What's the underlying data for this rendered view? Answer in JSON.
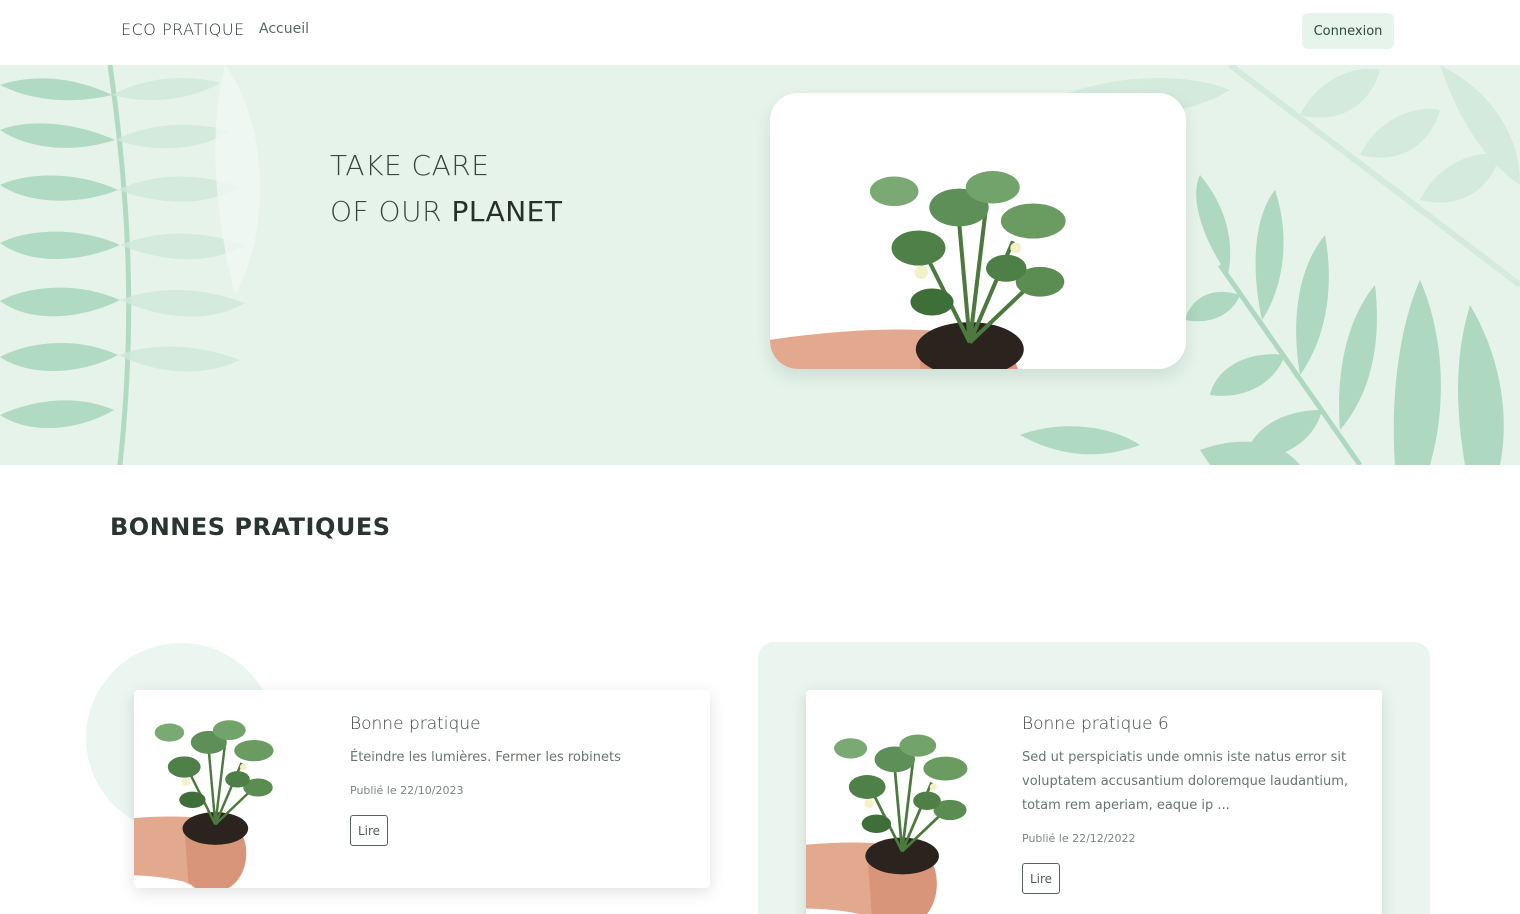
{
  "navbar": {
    "brand": "ECO PRATIQUE",
    "links": [
      "Accueil"
    ],
    "login_label": "Connexion"
  },
  "hero": {
    "title_line1": "TAKE CARE",
    "title_line2_light": "OF OUR ",
    "title_line2_bold": "PLANET"
  },
  "section": {
    "title": "BONNES PRATIQUES"
  },
  "cards": [
    {
      "title": "Bonne pratique",
      "text": "Éteindre les lumières. Fermer les robinets",
      "date": "Publié le 22/10/2023",
      "button": "Lire"
    },
    {
      "title": "Bonne pratique 6",
      "text": "Sed ut perspiciatis unde omnis iste natus error sit voluptatem accusantium doloremque laudantium, totam rem aperiam, eaque ip ...",
      "date": "Publié le 22/12/2022",
      "button": "Lire"
    }
  ],
  "colors": {
    "hero_bg": "#e5f3eb",
    "leaf": "#a9d6bb",
    "accent": "#e7f4ec"
  }
}
